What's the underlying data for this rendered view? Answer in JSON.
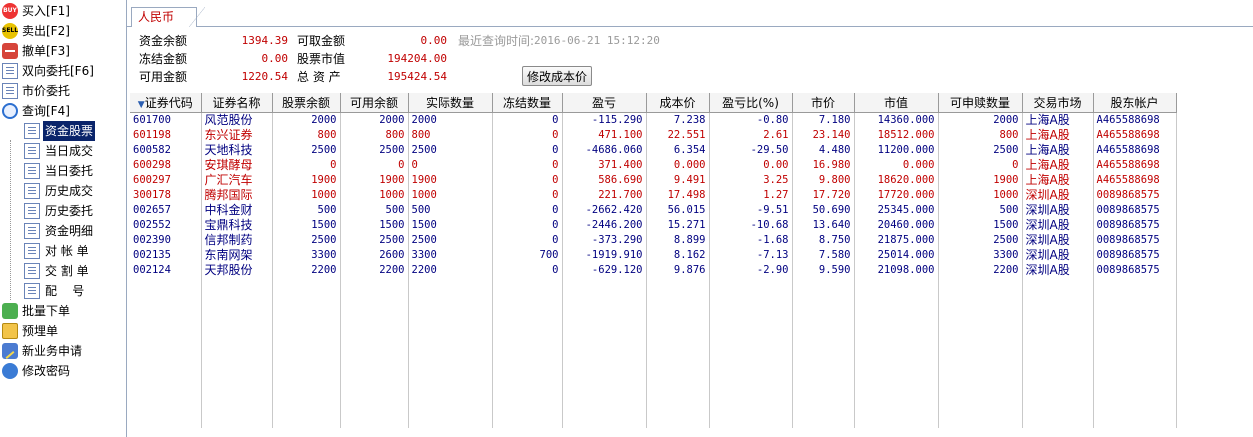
{
  "sidebar": {
    "items": [
      {
        "label": "买入[F1]",
        "icon": "buy-icon"
      },
      {
        "label": "卖出[F2]",
        "icon": "sell-icon"
      },
      {
        "label": "撤单[F3]",
        "icon": "cancel-icon"
      },
      {
        "label": "双向委托[F6]",
        "icon": "two-way-icon"
      },
      {
        "label": "市价委托",
        "icon": "market-order-icon"
      },
      {
        "label": "查询[F4]",
        "icon": "query-icon"
      },
      {
        "label": "资金股票",
        "icon": "document-icon",
        "selected": true
      },
      {
        "label": "当日成交",
        "icon": "document-icon"
      },
      {
        "label": "当日委托",
        "icon": "document-icon"
      },
      {
        "label": "历史成交",
        "icon": "document-icon"
      },
      {
        "label": "历史委托",
        "icon": "document-icon"
      },
      {
        "label": "资金明细",
        "icon": "document-icon"
      },
      {
        "label": "对 帐 单",
        "icon": "document-icon"
      },
      {
        "label": "交 割 单",
        "icon": "document-icon"
      },
      {
        "label": "配    号",
        "icon": "document-icon"
      },
      {
        "label": "批量下单",
        "icon": "batch-icon"
      },
      {
        "label": "预埋单",
        "icon": "folder-icon"
      },
      {
        "label": "新业务申请",
        "icon": "pen-icon"
      },
      {
        "label": "修改密码",
        "icon": "user-icon"
      }
    ]
  },
  "tab": {
    "label": "人民币"
  },
  "summary": {
    "fund_balance_label": "资金余额",
    "fund_balance": "1394.39",
    "withdrawable_label": "可取金额",
    "withdrawable": "0.00",
    "last_query_label": "最近查询时间:",
    "last_query_time": "2016-06-21 15:12:20",
    "frozen_label": "冻结金额",
    "frozen": "0.00",
    "stock_value_label": "股票市值",
    "stock_value": "194204.00",
    "available_label": "可用金额",
    "available": "1220.54",
    "total_assets_label": "总 资 产",
    "total_assets": "195424.54",
    "modify_cost_button": "修改成本价"
  },
  "table": {
    "columns": [
      "证券代码",
      "证券名称",
      "股票余额",
      "可用余额",
      "实际数量",
      "冻结数量",
      "盈亏",
      "成本价",
      "盈亏比(%)",
      "市价",
      "市值",
      "可申赎数量",
      "交易市场",
      "股东帐户"
    ],
    "rows": [
      {
        "color": "blue",
        "cells": [
          "601700",
          "风范股份",
          "2000",
          "2000",
          "2000",
          "0",
          "-115.290",
          "7.238",
          "-0.80",
          "7.180",
          "14360.000",
          "2000",
          "上海A股",
          "A465588698"
        ]
      },
      {
        "color": "red",
        "cells": [
          "601198",
          "东兴证券",
          "800",
          "800",
          "800",
          "0",
          "471.100",
          "22.551",
          "2.61",
          "23.140",
          "18512.000",
          "800",
          "上海A股",
          "A465588698"
        ]
      },
      {
        "color": "blue",
        "cells": [
          "600582",
          "天地科技",
          "2500",
          "2500",
          "2500",
          "0",
          "-4686.060",
          "6.354",
          "-29.50",
          "4.480",
          "11200.000",
          "2500",
          "上海A股",
          "A465588698"
        ]
      },
      {
        "color": "red",
        "cells": [
          "600298",
          "安琪酵母",
          "0",
          "0",
          "0",
          "0",
          "371.400",
          "0.000",
          "0.00",
          "16.980",
          "0.000",
          "0",
          "上海A股",
          "A465588698"
        ]
      },
      {
        "color": "red",
        "cells": [
          "600297",
          "广汇汽车",
          "1900",
          "1900",
          "1900",
          "0",
          "586.690",
          "9.491",
          "3.25",
          "9.800",
          "18620.000",
          "1900",
          "上海A股",
          "A465588698"
        ]
      },
      {
        "color": "red",
        "cells": [
          "300178",
          "腾邦国际",
          "1000",
          "1000",
          "1000",
          "0",
          "221.700",
          "17.498",
          "1.27",
          "17.720",
          "17720.000",
          "1000",
          "深圳A股",
          "0089868575"
        ]
      },
      {
        "color": "blue",
        "cells": [
          "002657",
          "中科金财",
          "500",
          "500",
          "500",
          "0",
          "-2662.420",
          "56.015",
          "-9.51",
          "50.690",
          "25345.000",
          "500",
          "深圳A股",
          "0089868575"
        ]
      },
      {
        "color": "blue",
        "cells": [
          "002552",
          "宝鼎科技",
          "1500",
          "1500",
          "1500",
          "0",
          "-2446.200",
          "15.271",
          "-10.68",
          "13.640",
          "20460.000",
          "1500",
          "深圳A股",
          "0089868575"
        ]
      },
      {
        "color": "blue",
        "cells": [
          "002390",
          "信邦制药",
          "2500",
          "2500",
          "2500",
          "0",
          "-373.290",
          "8.899",
          "-1.68",
          "8.750",
          "21875.000",
          "2500",
          "深圳A股",
          "0089868575"
        ]
      },
      {
        "color": "blue",
        "cells": [
          "002135",
          "东南网架",
          "3300",
          "2600",
          "3300",
          "700",
          "-1919.910",
          "8.162",
          "-7.13",
          "7.580",
          "25014.000",
          "3300",
          "深圳A股",
          "0089868575"
        ]
      },
      {
        "color": "blue",
        "cells": [
          "002124",
          "天邦股份",
          "2200",
          "2200",
          "2200",
          "0",
          "-629.120",
          "9.876",
          "-2.90",
          "9.590",
          "21098.000",
          "2200",
          "深圳A股",
          "0089868575"
        ]
      }
    ]
  }
}
